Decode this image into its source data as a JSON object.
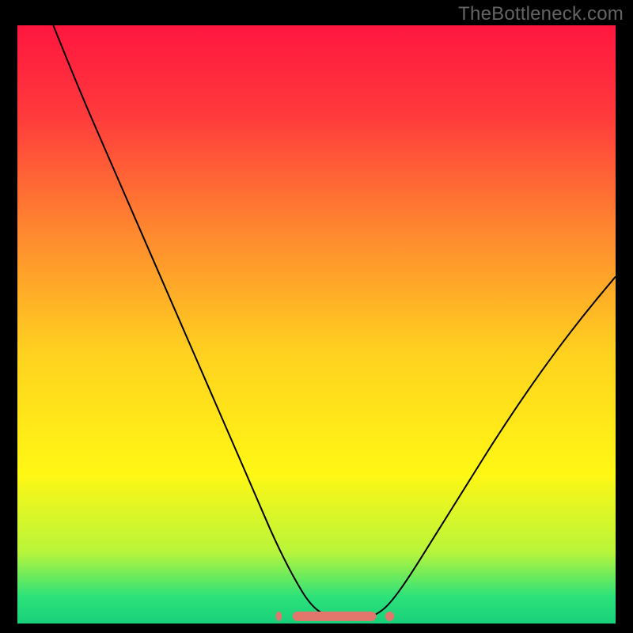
{
  "watermark": "TheBottleneck.com",
  "chart_data": {
    "type": "line",
    "title": "",
    "xlabel": "",
    "ylabel": "",
    "xlim": [
      0,
      100
    ],
    "ylim": [
      0,
      100
    ],
    "grid": false,
    "legend": false,
    "gradient_stops": [
      {
        "offset": 0.0,
        "color": "#ff163f"
      },
      {
        "offset": 0.15,
        "color": "#ff3a3c"
      },
      {
        "offset": 0.35,
        "color": "#ff8a2f"
      },
      {
        "offset": 0.55,
        "color": "#ffd21f"
      },
      {
        "offset": 0.75,
        "color": "#fff714"
      },
      {
        "offset": 0.88,
        "color": "#b9f53a"
      },
      {
        "offset": 0.955,
        "color": "#2de27a"
      },
      {
        "offset": 1.0,
        "color": "#18d07b"
      }
    ],
    "series": [
      {
        "name": "bottleneck-curve",
        "color": "#000000",
        "width": 2,
        "x": [
          6,
          10,
          15,
          20,
          25,
          30,
          35,
          40,
          43,
          46,
          49,
          52,
          55,
          58,
          60,
          62,
          65,
          70,
          75,
          80,
          85,
          90,
          95,
          100
        ],
        "y": [
          100,
          90,
          78.5,
          67,
          55.5,
          44,
          32.5,
          21,
          14,
          8,
          3,
          1,
          0.5,
          0.7,
          1.5,
          3,
          7,
          15,
          23,
          31,
          38.5,
          45.5,
          52,
          58
        ]
      },
      {
        "name": "optimal-range-marker",
        "color": "#e2766c",
        "type": "marker-band",
        "x_segments": [
          [
            43.2,
            44.2
          ],
          [
            46.0,
            60.0
          ],
          [
            61.5,
            63.0
          ]
        ],
        "y_level": 1.2,
        "thickness": 12
      }
    ]
  }
}
